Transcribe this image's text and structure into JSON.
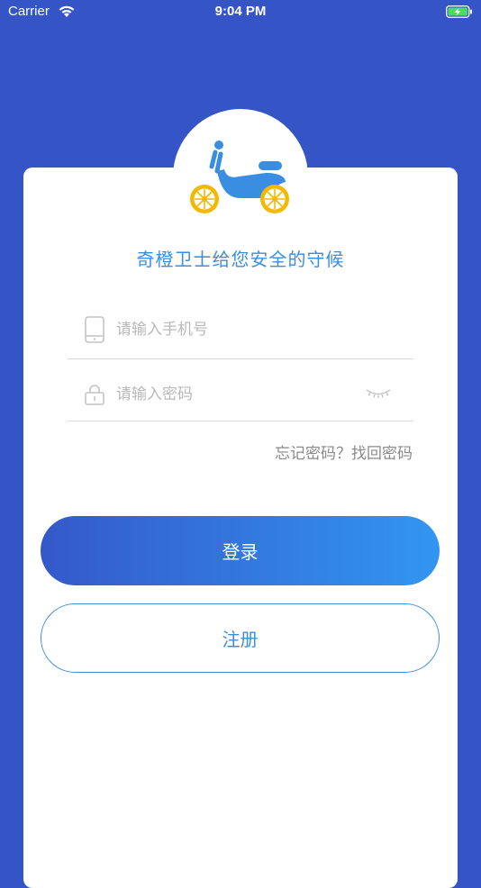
{
  "status_bar": {
    "carrier": "Carrier",
    "time": "9:04 PM"
  },
  "header": {
    "tagline": "奇橙卫士给您安全的守候"
  },
  "login_form": {
    "phone_placeholder": "请输入手机号",
    "phone_value": "",
    "password_placeholder": "请输入密码",
    "password_value": "",
    "forgot_link": "忘记密码？找回密码",
    "login_button": "登录",
    "register_button": "注册"
  },
  "icons": {
    "status": [
      "wifi-icon",
      "battery-charging-icon"
    ],
    "logo": "scooter-icon",
    "fields": [
      "phone-icon",
      "lock-icon",
      "eye-closed-icon"
    ]
  },
  "colors": {
    "background": "#3555C6",
    "accent": "#3A8EE2",
    "scooter_body": "#3A8EE2",
    "wheel": "#F5B800",
    "login_gradient_start": "#3459C8",
    "login_gradient_end": "#3296F0"
  }
}
